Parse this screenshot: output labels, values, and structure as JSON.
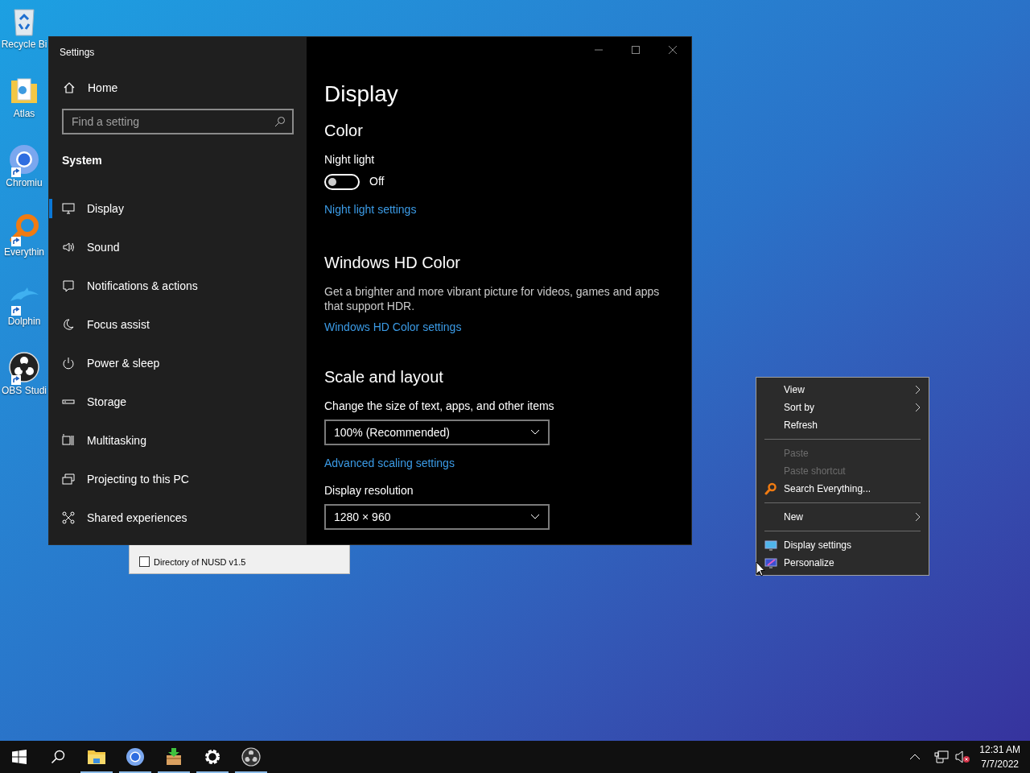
{
  "desktop_icons": [
    {
      "label": "Recycle Bi",
      "kind": "recycle",
      "shortcut": false
    },
    {
      "label": "Atlas",
      "kind": "folder",
      "shortcut": false
    },
    {
      "label": "Chromiu",
      "kind": "chromium",
      "shortcut": true
    },
    {
      "label": "Everythin",
      "kind": "everything",
      "shortcut": true
    },
    {
      "label": "Dolphin",
      "kind": "dolphin",
      "shortcut": true
    },
    {
      "label": "OBS Studi",
      "kind": "obs",
      "shortcut": true
    }
  ],
  "back_window": {
    "items": [
      {
        "label": "Directory of NUSD v1.5",
        "checked": false
      }
    ]
  },
  "settings": {
    "title": "Settings",
    "home": "Home",
    "search": {
      "placeholder": "Find a setting"
    },
    "category": "System",
    "nav": [
      {
        "label": "Display",
        "kind": "display",
        "selected": true
      },
      {
        "label": "Sound",
        "kind": "sound",
        "selected": false
      },
      {
        "label": "Notifications & actions",
        "kind": "notifications",
        "selected": false
      },
      {
        "label": "Focus assist",
        "kind": "focus",
        "selected": false
      },
      {
        "label": "Power & sleep",
        "kind": "power",
        "selected": false
      },
      {
        "label": "Storage",
        "kind": "storage",
        "selected": false
      },
      {
        "label": "Multitasking",
        "kind": "multitasking",
        "selected": false
      },
      {
        "label": "Projecting to this PC",
        "kind": "projecting",
        "selected": false
      },
      {
        "label": "Shared experiences",
        "kind": "shared",
        "selected": false
      }
    ],
    "content": {
      "title": "Display",
      "color_heading": "Color",
      "night_light": {
        "label": "Night light",
        "on": false,
        "state": "Off"
      },
      "night_link": "Night light settings",
      "hdr_heading": "Windows HD Color",
      "hdr_text": "Get a brighter and more vibrant picture for videos, games and apps that support HDR.",
      "hdr_link": "Windows HD Color settings",
      "scale_heading": "Scale and layout",
      "scale_label": "Change the size of text, apps, and other items",
      "scale_value": "100% (Recommended)",
      "scale_link": "Advanced scaling settings",
      "resolution_label": "Display resolution",
      "resolution_value": "1280 × 960"
    }
  },
  "context_menu": [
    {
      "kind": "item",
      "label": "View",
      "submenu": true,
      "disabled": false
    },
    {
      "kind": "item",
      "label": "Sort by",
      "submenu": true,
      "disabled": false
    },
    {
      "kind": "item",
      "label": "Refresh",
      "submenu": false,
      "disabled": false
    },
    {
      "kind": "separator"
    },
    {
      "kind": "item",
      "label": "Paste",
      "submenu": false,
      "disabled": true
    },
    {
      "kind": "item",
      "label": "Paste shortcut",
      "submenu": false,
      "disabled": true
    },
    {
      "kind": "search",
      "label": "Search Everything...",
      "submenu": false,
      "disabled": false
    },
    {
      "kind": "separator"
    },
    {
      "kind": "item",
      "label": "New",
      "submenu": true,
      "disabled": false
    },
    {
      "kind": "separator"
    },
    {
      "kind": "display",
      "label": "Display settings",
      "submenu": false,
      "disabled": false
    },
    {
      "kind": "personalize",
      "label": "Personalize",
      "submenu": false,
      "disabled": false
    }
  ],
  "taskbar": {
    "apps": [
      {
        "kind": "explorer",
        "running": true
      },
      {
        "kind": "chromium",
        "running": true
      },
      {
        "kind": "package",
        "running": true
      },
      {
        "kind": "settings",
        "running": true
      },
      {
        "kind": "obs",
        "running": true
      }
    ],
    "time": "12:31 AM",
    "date": "7/7/2022"
  }
}
